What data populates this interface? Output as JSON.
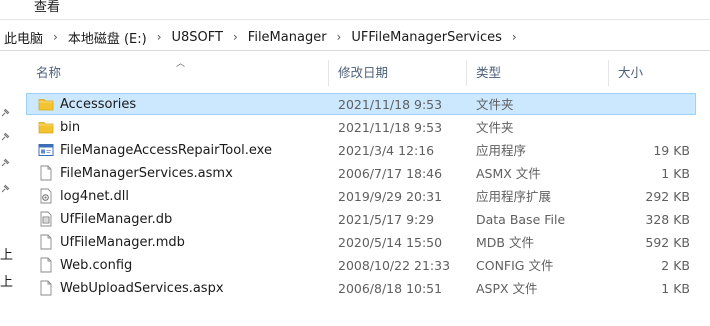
{
  "menu": {
    "view_label": "查看"
  },
  "breadcrumb": [
    "此电脑",
    "本地磁盘 (E:)",
    "U8SOFT",
    "FileManager",
    "UFFileManagerServices"
  ],
  "breadcrumb_separator": "›",
  "nav_pane": {
    "labels": [
      "上",
      "上"
    ]
  },
  "columns": {
    "name": "名称",
    "date": "修改日期",
    "type": "类型",
    "size": "大小"
  },
  "files": [
    {
      "name": "Accessories",
      "date": "2021/11/18 9:53",
      "type": "文件夹",
      "size": "",
      "icon": "folder-icon",
      "selected": true
    },
    {
      "name": "bin",
      "date": "2021/11/18 9:53",
      "type": "文件夹",
      "size": "",
      "icon": "folder-icon",
      "selected": false
    },
    {
      "name": "FileManageAccessRepairTool.exe",
      "date": "2021/3/4 12:16",
      "type": "应用程序",
      "size": "19 KB",
      "icon": "exe-icon",
      "selected": false
    },
    {
      "name": "FileManagerServices.asmx",
      "date": "2006/7/17 18:46",
      "type": "ASMX 文件",
      "size": "1 KB",
      "icon": "document-icon",
      "selected": false
    },
    {
      "name": "log4net.dll",
      "date": "2019/9/29 20:31",
      "type": "应用程序扩展",
      "size": "292 KB",
      "icon": "dll-icon",
      "selected": false
    },
    {
      "name": "UfFileManager.db",
      "date": "2021/5/17 9:29",
      "type": "Data Base File",
      "size": "328 KB",
      "icon": "database-file-icon",
      "selected": false
    },
    {
      "name": "UfFileManager.mdb",
      "date": "2020/5/14 15:50",
      "type": "MDB 文件",
      "size": "592 KB",
      "icon": "document-icon",
      "selected": false
    },
    {
      "name": "Web.config",
      "date": "2008/10/22 21:33",
      "type": "CONFIG 文件",
      "size": "2 KB",
      "icon": "document-icon",
      "selected": false
    },
    {
      "name": "WebUploadServices.aspx",
      "date": "2006/8/18 10:51",
      "type": "ASPX 文件",
      "size": "1 KB",
      "icon": "document-icon",
      "selected": false
    }
  ],
  "colors": {
    "selection_bg": "#cce8ff",
    "selection_border": "#99d1ff",
    "folder": "#f4c430",
    "header_text": "#4c607a"
  }
}
